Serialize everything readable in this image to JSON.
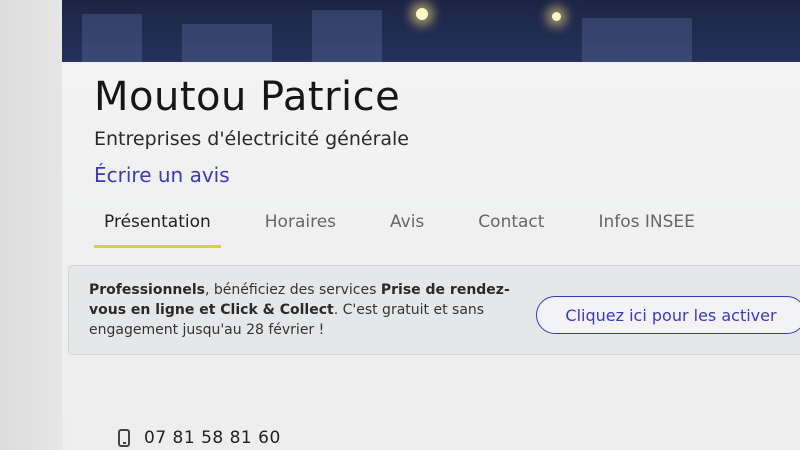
{
  "business": {
    "name": "Moutou Patrice",
    "category": "Entreprises d'électricité générale",
    "review_link": "Écrire un avis"
  },
  "tabs": [
    {
      "label": "Présentation",
      "active": true
    },
    {
      "label": "Horaires",
      "active": false
    },
    {
      "label": "Avis",
      "active": false
    },
    {
      "label": "Contact",
      "active": false
    },
    {
      "label": "Infos INSEE",
      "active": false
    }
  ],
  "promo": {
    "part1_bold": "Professionnels",
    "part2": ", bénéficiez des services ",
    "part3_bold": "Prise de rendez-vous en ligne et Click & Collect",
    "part4": ". C'est gratuit et sans engagement jusqu'au 28 février !",
    "button_label": "Cliquez ici pour les activer"
  },
  "contact": {
    "phone": "07 81 58 81 60"
  },
  "colors": {
    "accent_link": "#3a3ab8",
    "tab_underline": "#d8d42a",
    "banner": "#1b2444"
  }
}
